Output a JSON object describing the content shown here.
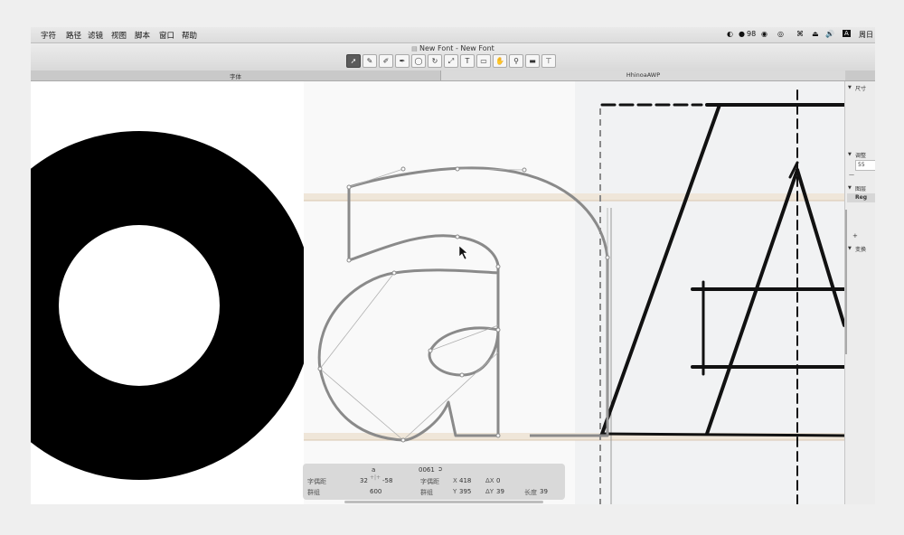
{
  "menubar": {
    "menus": [
      "字符",
      "路径",
      "滤镜",
      "视图",
      "脚本",
      "窗口",
      "帮助"
    ],
    "status": {
      "percent": "98",
      "clock": "周日"
    }
  },
  "window": {
    "title": "New Font - New Font"
  },
  "toolbar": {
    "tools": [
      {
        "name": "select-tool-icon",
        "glyph": "➚",
        "active": true
      },
      {
        "name": "pen-tool-icon",
        "glyph": "✎",
        "active": false
      },
      {
        "name": "pencil-tool-icon",
        "glyph": "✐",
        "active": false
      },
      {
        "name": "brush-tool-icon",
        "glyph": "✒",
        "active": false
      },
      {
        "name": "shape-tool-icon",
        "glyph": "◯",
        "active": false
      },
      {
        "name": "rotate-tool-icon",
        "glyph": "↻",
        "active": false
      },
      {
        "name": "scale-tool-icon",
        "glyph": "⤢",
        "active": false
      },
      {
        "name": "text-tool-icon",
        "glyph": "T",
        "active": false
      },
      {
        "name": "annotation-tool-icon",
        "glyph": "▭",
        "active": false
      },
      {
        "name": "hand-tool-icon",
        "glyph": "✋",
        "active": false
      },
      {
        "name": "zoom-tool-icon",
        "glyph": "⚲",
        "active": false
      },
      {
        "name": "measure-tool-icon",
        "glyph": "▬",
        "active": false
      },
      {
        "name": "tt-tool-icon",
        "glyph": "⊤",
        "active": false
      }
    ]
  },
  "tabs": {
    "left": "字体",
    "right": "HhinoaAWP"
  },
  "sidebar": {
    "dimensions_label": "尺寸",
    "adjust_label": "调整",
    "layers_label": "图层",
    "layer_name": "Reg",
    "layer_value": "55",
    "transform_label": "变换",
    "plus": "+",
    "minus": "—"
  },
  "infopanel": {
    "glyph_name": "a",
    "unicode": "0061",
    "lsb_label": "字偶距",
    "lsb": "32",
    "rsb": "-58",
    "width_label": "群组",
    "width": "600",
    "x_label": "X",
    "x": "418",
    "y_label": "Y",
    "y": "395",
    "dx_label": "ΔX",
    "dx": "0",
    "dy_label": "ΔY",
    "dy": "39",
    "length_label": "长度",
    "length": "39",
    "kern_label": "字偶距",
    "group_label": "群组"
  },
  "colors": {
    "accent": "#5b5b5b",
    "guide": "#e7d7c2",
    "path": "#8a8a8a"
  }
}
